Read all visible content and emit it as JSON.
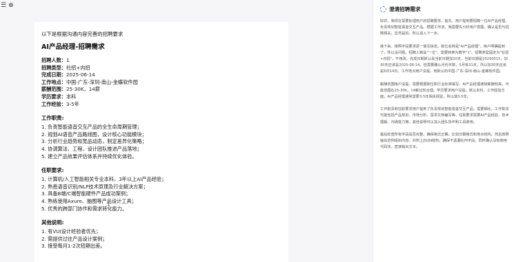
{
  "topbar": {
    "collapse_glyph": "☰",
    "add_glyph": "⊕"
  },
  "document": {
    "intro": "以下是根据沟通内容完善的招聘要求",
    "title": "AI产品经理-招聘需求",
    "info": [
      {
        "label": "招聘人数：",
        "value": "1"
      },
      {
        "label": "招聘类型：",
        "value": "社招+内招"
      },
      {
        "label": "完成日期：",
        "value": "2025-06-14"
      },
      {
        "label": "工作地点：",
        "value": "中国-广东-深圳-南山-金蝶软件园"
      },
      {
        "label": "薪酬范围：",
        "value": "25-30K，14薪"
      },
      {
        "label": "学历要求：",
        "value": "本科"
      },
      {
        "label": "工作经验：",
        "value": "3-5年"
      }
    ],
    "duties_heading": "工作职责:",
    "duties": [
      "1. 负责智能语音交互产品的全生命周期管理；",
      "2. 规划AI语音产品路线图，设计核心功能模块；",
      "3. 分析行业趋势和竞品动态，制定差异化策略；",
      "4. 协调算法、工程、设计团队推进产品落地；",
      "5. 建立产品效果评估体系并持续优化体验。"
    ],
    "requirements_heading": "任职要求:",
    "requirements": [
      "1. 计算机/人工智能相关专业本科，3年以上AI产品经验；",
      "2. 熟悉语音识别/NLP技术原理及行业解决方案；",
      "3. 具备B端/C端智能硬件产品成功案例；",
      "4. 熟练使用Axure、脑图等产品设计工具；",
      "5. 优秀的跨部门协作和需求转化能力。"
    ],
    "other_heading": "其他说明:",
    "other": [
      "1. 有VUI设计经验者优先；",
      "2. 需提供过往产品设计案例；",
      "3. 接受每月1-2次短期出差。"
    ]
  },
  "panel": {
    "title": "澄清招聘需求",
    "paragraphs": [
      "好的，我现在需要处理用户的招聘要求。首先，用户提到要招聘一位AI产品经理，负责规划智能语音交互产品。根据工作流，我需要先分析用户意图，确认是否与招聘相关。显然是的，所以进入下一步。",
      "接下来，按照字段要求逐一填写信息。职位名称是\"AI产品经理\"，用户明确提到了，所以没问题。招聘人数是\"一位\"，需要转换为数字\"1\"。招聘类型固定为\"社招+内招\"，不用改。完成日期默认是当前日期加30天，当前日期是20250515，加30天应该是2025-06-14。但需要确认月份天数，5月有31天，所以加30天应该是6月14日。工作地点用户没提，用默认的中国-广东-深圳-南山-金蝶软件园。",
      "薪酬范围用户没提，需要根据职位和行业标准填写。AI产品经理通常薪酬较高，可能范围在25-30K，14薪比较合理。学历要求用户没提，默认本科。工作经验方面，AI产品经理通常需要3-5年相关经验，所以填3-5年。",
      "工作职责和任职要求用户提到了负责规划智能语音交互产品，需要细化。工作职责可能包括产品规划、市场分析、需求文档编写等。任职要求需要AI产品经验、技术理解、沟通能力等。其他说明可以加入团队协作和工具使用。",
      "最后检查所有字段是否完整，确保格式正确。比如日期格式和地点结构。然后按照输出范例组织内容，并附上JSON结构，确保不遗漏任何字段。同时确认没有使用代码块，直接输出文本。"
    ]
  }
}
